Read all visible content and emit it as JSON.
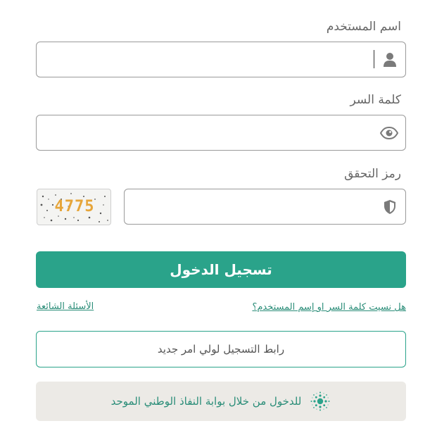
{
  "username": {
    "label": "اسم المستخدم",
    "value": "",
    "icon": "user-icon"
  },
  "password": {
    "label": "كلمة السر",
    "value": "",
    "icon": "eye-icon"
  },
  "captcha": {
    "label": "رمز التحقق",
    "value": "",
    "icon": "shield-icon",
    "image_text": "4775"
  },
  "login_button": "تسجيل الدخول",
  "forgot_link": "هل نسيت كلمة السر او إسم المستخدم؟",
  "faq_link": "الأسئلة الشائعة",
  "guardian_register": "رابط التسجيل لولي امر جديد",
  "nafath_login": "للدخول من خلال بوابة النفاذ الوطني الموحد",
  "colors": {
    "accent": "#2aa38a",
    "link": "#2a8d78",
    "border": "#9a9a9a",
    "nafath_bg": "#eceae6"
  }
}
